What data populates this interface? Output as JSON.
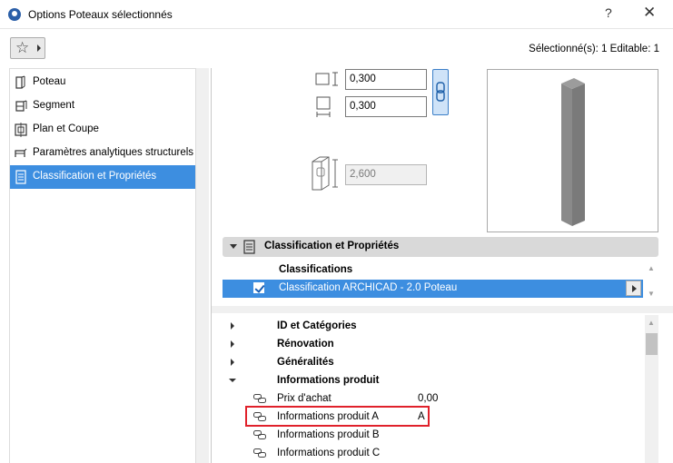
{
  "window": {
    "title": "Options Poteaux sélectionnés",
    "help_label": "?",
    "close_label": "✕"
  },
  "toolbar": {
    "favorites_icon": "star-icon",
    "selection_info": "Sélectionné(s): 1 Editable: 1"
  },
  "sidebar": {
    "items": [
      {
        "label": "Poteau",
        "icon": "column-icon",
        "selected": false
      },
      {
        "label": "Segment",
        "icon": "segment-icon",
        "selected": false
      },
      {
        "label": "Plan et Coupe",
        "icon": "floor-plan-icon",
        "selected": false
      },
      {
        "label": "Paramètres analytiques structurels",
        "icon": "structural-analysis-icon",
        "selected": false
      },
      {
        "label": "Classification et Propriétés",
        "icon": "classification-icon",
        "selected": true
      }
    ]
  },
  "geometry": {
    "width_value": "0,300",
    "depth_value": "0,300",
    "height_value": "2,600"
  },
  "section": {
    "label": "Classification et Propriétés"
  },
  "classifications": {
    "header": "Classifications",
    "row_value": "Classification ARCHICAD - 2.0 Poteau",
    "checked": true
  },
  "properties": {
    "groups": [
      {
        "label": "ID et Catégories",
        "expanded": false
      },
      {
        "label": "Rénovation",
        "expanded": false
      },
      {
        "label": "Généralités",
        "expanded": false
      },
      {
        "label": "Informations produit",
        "expanded": true
      }
    ],
    "items": [
      {
        "label": "Prix d'achat",
        "value": "0,00"
      },
      {
        "label": "Informations produit A",
        "value": "A"
      },
      {
        "label": "Informations produit B",
        "value": ""
      },
      {
        "label": "Informations produit C",
        "value": ""
      }
    ]
  },
  "colors": {
    "selection_blue": "#3d8ee0",
    "highlight_red": "#e0212b",
    "section_gray": "#d9d9d9"
  }
}
